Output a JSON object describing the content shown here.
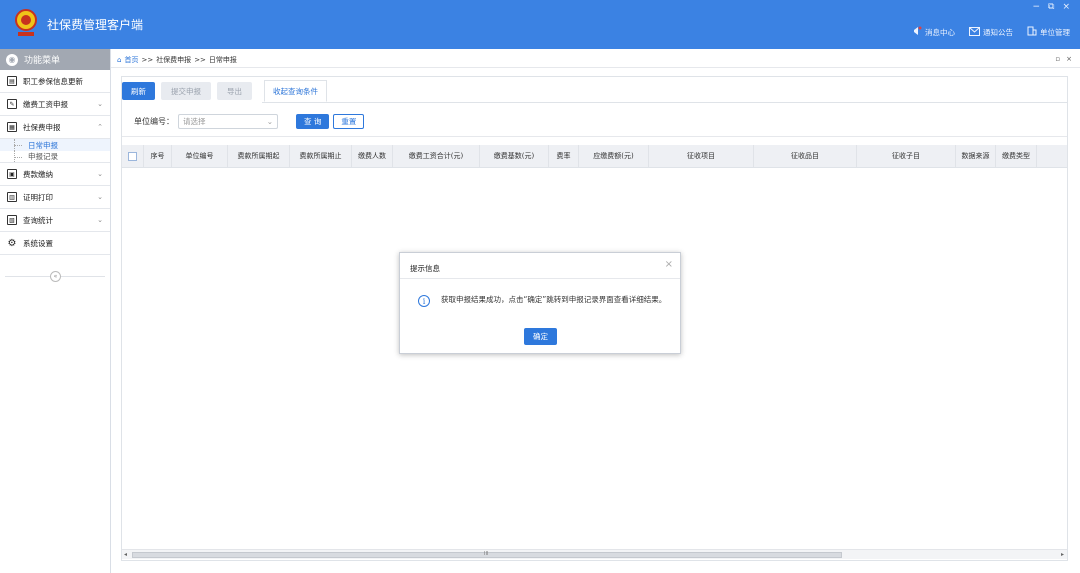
{
  "app": {
    "title": "社保费管理客户端",
    "logo_text": "中国税务",
    "window_controls": [
      "−",
      "⧉",
      "×"
    ],
    "topnav": [
      {
        "label": "消息中心",
        "icon": "bell-icon"
      },
      {
        "label": "通知公告",
        "icon": "mail-icon"
      },
      {
        "label": "单位管理",
        "icon": "building-icon"
      }
    ]
  },
  "sidebar": {
    "header": "功能菜单",
    "items": [
      {
        "label": "职工参保信息更新",
        "icon": "id-card-icon",
        "chevron": ""
      },
      {
        "label": "缴费工资申报",
        "icon": "edit-icon",
        "chevron": "⌄"
      },
      {
        "label": "社保费申报",
        "icon": "form-icon",
        "chevron": "⌃"
      },
      {
        "label": "费款缴纳",
        "icon": "payment-icon",
        "chevron": "⌄"
      },
      {
        "label": "证明打印",
        "icon": "printer-icon",
        "chevron": "⌄"
      },
      {
        "label": "查询统计",
        "icon": "chart-icon",
        "chevron": "⌄"
      },
      {
        "label": "系统设置",
        "icon": "gear-icon",
        "chevron": ""
      }
    ],
    "subitems": [
      {
        "label": "日常申报"
      },
      {
        "label": "申报记录"
      }
    ],
    "collapse": "«"
  },
  "breadcrumb": {
    "home": "首页",
    "sep": ">>",
    "level1": "社保费申报",
    "level2": "日常申报",
    "right_icons": [
      "▫",
      "×"
    ]
  },
  "toolbar": {
    "refresh": "刷新",
    "submit": "提交申报",
    "export": "导出",
    "toggle_conditions": "收起查询条件"
  },
  "search": {
    "label": "单位编号：",
    "placeholder": "请选择",
    "query": "查 询",
    "reset": "重置"
  },
  "table": {
    "columns": [
      "序号",
      "单位编号",
      "费款所属期起",
      "费款所属期止",
      "缴费人数",
      "缴费工资合计(元)",
      "缴费基数(元)",
      "费率",
      "应缴费额(元)",
      "征收项目",
      "征收品目",
      "征收子目",
      "数据来源",
      "缴费类型"
    ]
  },
  "scrollbar": {
    "left": "◂",
    "right": "▸",
    "grip": "III"
  },
  "dialog": {
    "title": "提示信息",
    "message": "获取申报结果成功，点击“确定”跳转到申报记录界面查看详细结果。",
    "ok": "确定",
    "close": "×",
    "info_icon": "i"
  }
}
